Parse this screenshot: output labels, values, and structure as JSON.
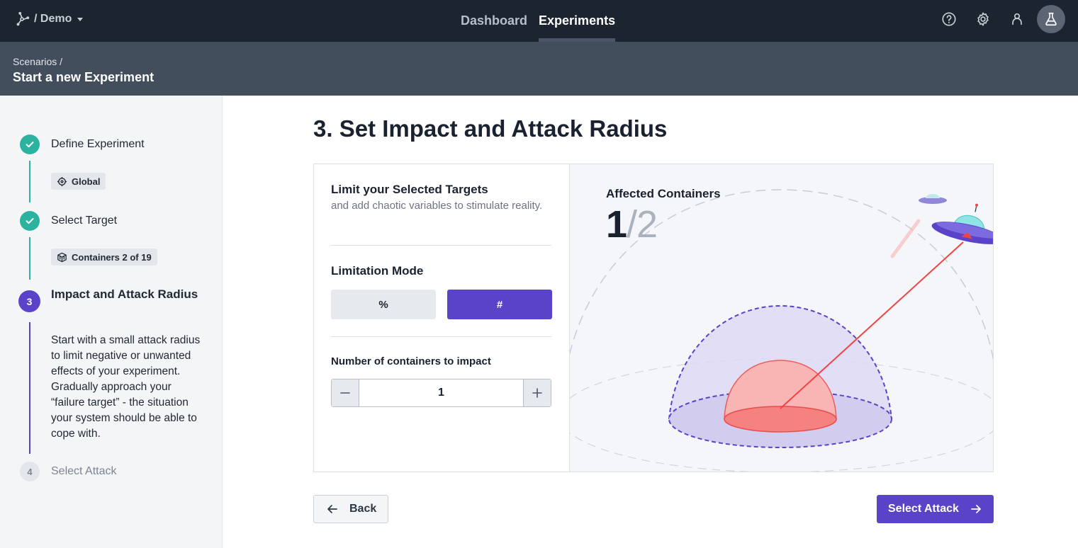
{
  "topbar": {
    "workspace": "/ Demo",
    "tabs": [
      {
        "label": "Dashboard"
      },
      {
        "label": "Experiments"
      }
    ]
  },
  "subheader": {
    "breadcrumb": "Scenarios /",
    "title": "Start a new Experiment"
  },
  "sidebar": {
    "steps": [
      {
        "label": "Define Experiment",
        "chip": "Global"
      },
      {
        "label": "Select Target",
        "chip": "Containers 2 of 19"
      },
      {
        "number": "3",
        "label": "Impact and Attack Radius",
        "description": "Start with a small attack radius to limit negative or unwanted effects of your experiment. Gradually approach your “failure target” - the situation your system should be able to cope with."
      },
      {
        "number": "4",
        "label": "Select Attack"
      }
    ]
  },
  "main": {
    "title": "3. Set Impact and Attack Radius",
    "limit_title": "Limit your Selected Targets",
    "limit_subtitle": "and add chaotic variables to stimulate reality.",
    "mode_title": "Limitation Mode",
    "mode_options": [
      "%",
      "#"
    ],
    "count_title": "Number of containers to impact",
    "count_value": "1",
    "affected_title": "Affected Containers",
    "affected_current": "1",
    "affected_total": "/2"
  },
  "footer": {
    "back_label": "Back",
    "next_label": "Select Attack"
  },
  "colors": {
    "accent": "#5a43c9",
    "done": "#2bb3a0",
    "topbar": "#1c2430",
    "subheader": "#434e5d"
  }
}
